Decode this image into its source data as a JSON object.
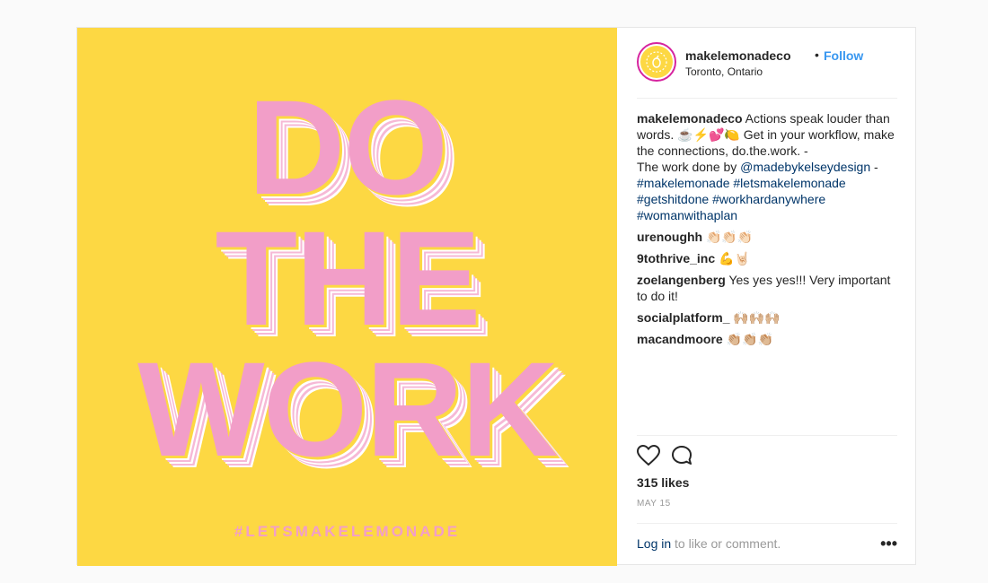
{
  "post": {
    "image": {
      "line1": "DO",
      "line2": "THE",
      "line3": "WORK",
      "hashtag": "#LETSMAKELEMONADE",
      "bg": "#fdd843",
      "accent": "#f29ec8"
    },
    "header": {
      "username": "makelemonadeco",
      "dot": "•",
      "follow": "Follow",
      "location": "Toronto, Ontario"
    },
    "caption": {
      "username": "makelemonadeco",
      "text1": "Actions speak louder than words. ☕⚡💕🍋 Get in your workflow, make the connections, do.the.work. -",
      "text2": "The work done by ",
      "mention": "@madebykelseydesign",
      "text3": " -",
      "tags": "#makelemonade #letsmakelemonade #getshitdone #workhardanywhere #womanwithaplan"
    },
    "comments": [
      {
        "user": "urenoughh",
        "text": "👏🏻👏🏻👏🏻"
      },
      {
        "user": "9tothrive_inc",
        "text": "💪🤘🏻"
      },
      {
        "user": "zoelangenberg",
        "text": "Yes yes yes!!! Very important to do it!"
      },
      {
        "user": "socialplatform_",
        "text": "🙌🏼🙌🏼🙌🏼"
      },
      {
        "user": "macandmoore",
        "text": "👏🏼👏🏼👏🏼"
      }
    ],
    "likes": "315 likes",
    "date": "MAY 15",
    "footer": {
      "login": "Log in",
      "rest": " to like or comment.",
      "more": "•••"
    },
    "icons": [
      "heart-icon",
      "comment-icon",
      "more-icon"
    ]
  }
}
